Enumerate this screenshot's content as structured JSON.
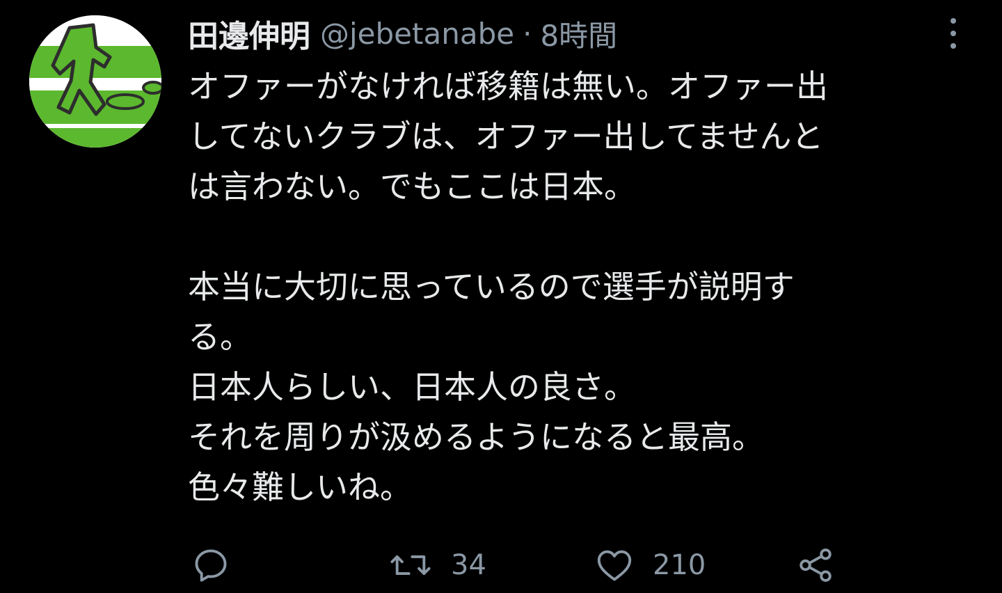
{
  "tweet": {
    "author": {
      "display_name": "田邊伸明",
      "handle": "@jebetanabe",
      "separator": "·",
      "timestamp": "8時間"
    },
    "body_lines": [
      "オファーがなければ移籍は無い。オファー出",
      "してないクラブは、オファー出してませんと",
      "は言わない。でもここは日本。",
      "",
      "本当に大切に思っているので選手が説明す",
      "る。",
      "日本人らしい、日本人の良さ。",
      "それを周りが汲めるようになると最高。",
      "色々難しいね。"
    ],
    "actions": {
      "reply": {
        "icon": "reply-icon",
        "count": ""
      },
      "retweet": {
        "icon": "retweet-icon",
        "count": "34"
      },
      "like": {
        "icon": "heart-icon",
        "count": "210"
      },
      "share": {
        "icon": "share-icon",
        "count": ""
      }
    }
  },
  "colors": {
    "background": "#000000",
    "text_primary": "#e7e9ea",
    "text_secondary": "#8b98a5",
    "avatar_green": "#5cb82e"
  }
}
